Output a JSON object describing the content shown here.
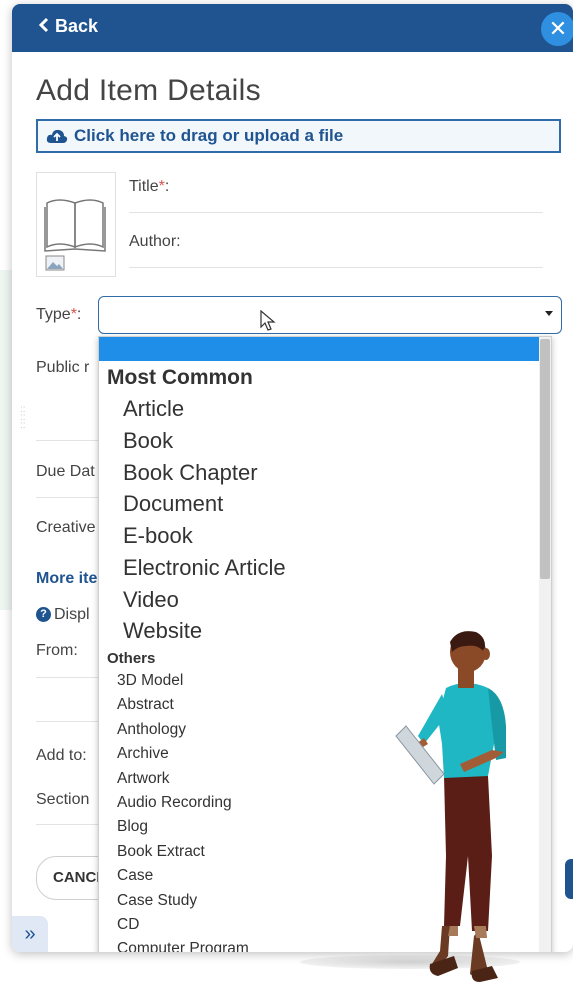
{
  "header": {
    "back_label": "Back",
    "close_symbol": "✕"
  },
  "page": {
    "title": "Add Item Details"
  },
  "upload": {
    "label": "Click here to drag or upload a file"
  },
  "form": {
    "title_label": "Title",
    "author_label": "Author:",
    "type_label": "Type",
    "required_mark": "*",
    "colon": ":",
    "public_label": "Public r",
    "due_label": "Due Dat",
    "creative_label": "Creative",
    "more_label": "More ite",
    "display_label": "Displ",
    "from_label": "From:",
    "add_to_label": "Add to:",
    "section_label": "Section"
  },
  "buttons": {
    "cancel": "CANCEL",
    "expand": "»"
  },
  "dropdown": {
    "group_common": "Most Common",
    "common_items": [
      "Article",
      "Book",
      "Book Chapter",
      "Document",
      "E-book",
      "Electronic Article",
      "Video",
      "Website"
    ],
    "group_others": "Others",
    "other_items": [
      "3D Model",
      "Abstract",
      "Anthology",
      "Archive",
      "Artwork",
      "Audio Recording",
      "Blog",
      "Book Extract",
      "Case",
      "Case Study",
      "CD",
      "Computer Program"
    ]
  },
  "colors": {
    "header": "#1f5491",
    "accent": "#2f8fe0",
    "selected": "#1e8ee8",
    "required": "#d9534f"
  },
  "icons": [
    "chevron-left-icon",
    "close-icon",
    "cloud-upload-icon",
    "book-icon",
    "image-icon",
    "caret-down-icon",
    "mouse-cursor-icon",
    "help-icon",
    "double-chevron-icon"
  ]
}
